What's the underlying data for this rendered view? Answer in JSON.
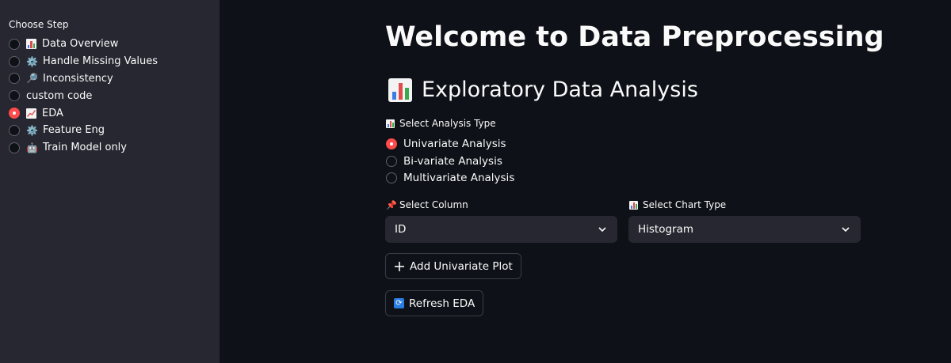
{
  "sidebar": {
    "heading": "Choose Step",
    "options": [
      {
        "label": "Data Overview",
        "icon": "bar-chart-icon",
        "selected": false
      },
      {
        "label": "Handle Missing Values",
        "icon": "gear-icon",
        "selected": false
      },
      {
        "label": "Inconsistency",
        "icon": "magnifier-icon",
        "selected": false
      },
      {
        "label": "custom code",
        "icon": "",
        "selected": false
      },
      {
        "label": "EDA",
        "icon": "line-chart-icon",
        "selected": true
      },
      {
        "label": "Feature Eng",
        "icon": "gear-icon",
        "selected": false
      },
      {
        "label": "Train Model only",
        "icon": "robot-icon",
        "selected": false
      }
    ]
  },
  "main": {
    "title": "Welcome to Data Preprocessing",
    "section_title": "Exploratory Data Analysis",
    "analysis_type_label": "Select Analysis Type",
    "analysis_options": [
      {
        "label": "Univariate Analysis",
        "selected": true
      },
      {
        "label": "Bi-variate Analysis",
        "selected": false
      },
      {
        "label": "Multivariate Analysis",
        "selected": false
      }
    ],
    "column_label": "Select Column",
    "column_value": "ID",
    "chart_type_label": "Select Chart Type",
    "chart_type_value": "Histogram",
    "add_plot_button": "Add Univariate Plot",
    "refresh_button": "Refresh EDA"
  },
  "colors": {
    "accent": "#ff4b4b",
    "background": "#0e1117",
    "sidebar_bg": "#262730",
    "text": "#fafafa"
  }
}
